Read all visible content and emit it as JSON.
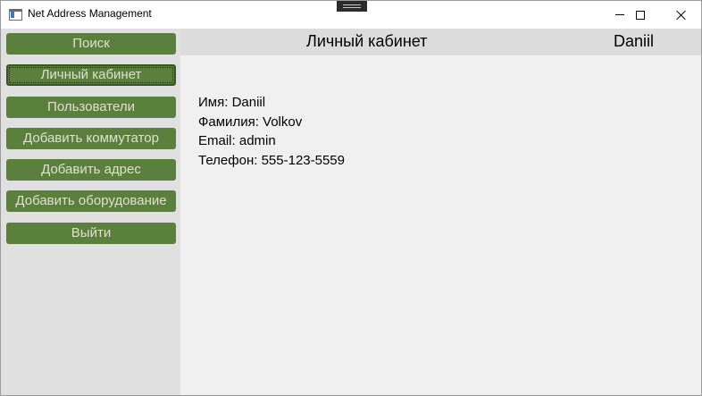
{
  "window": {
    "title": "Net Address Management"
  },
  "sidebar": {
    "items": [
      {
        "label": "Поиск"
      },
      {
        "label": "Личный кабинет"
      },
      {
        "label": "Пользователи"
      },
      {
        "label": "Добавить коммутатор"
      },
      {
        "label": "Добавить адрес"
      },
      {
        "label": "Добавить оборудование"
      },
      {
        "label": "Выйти"
      }
    ],
    "selected_index": 1
  },
  "header": {
    "title": "Личный кабинет",
    "user": "Daniil"
  },
  "profile": {
    "first_name_label": "Имя:",
    "first_name": "Daniil",
    "last_name_label": "Фамилия:",
    "last_name": "Volkov",
    "email_label": "Email:",
    "email": "admin",
    "phone_label": "Телефон:",
    "phone": "555-123-5559"
  },
  "colors": {
    "button_bg": "#5b7f3c",
    "button_text": "#e0e0d0",
    "sidebar_bg": "#e0e0e0",
    "header_bg": "#dcdcdc",
    "content_bg": "#f0f0f0"
  },
  "icons": {
    "app": "app-window-icon",
    "minimize": "minimize-icon",
    "maximize": "maximize-icon",
    "close": "close-icon"
  }
}
